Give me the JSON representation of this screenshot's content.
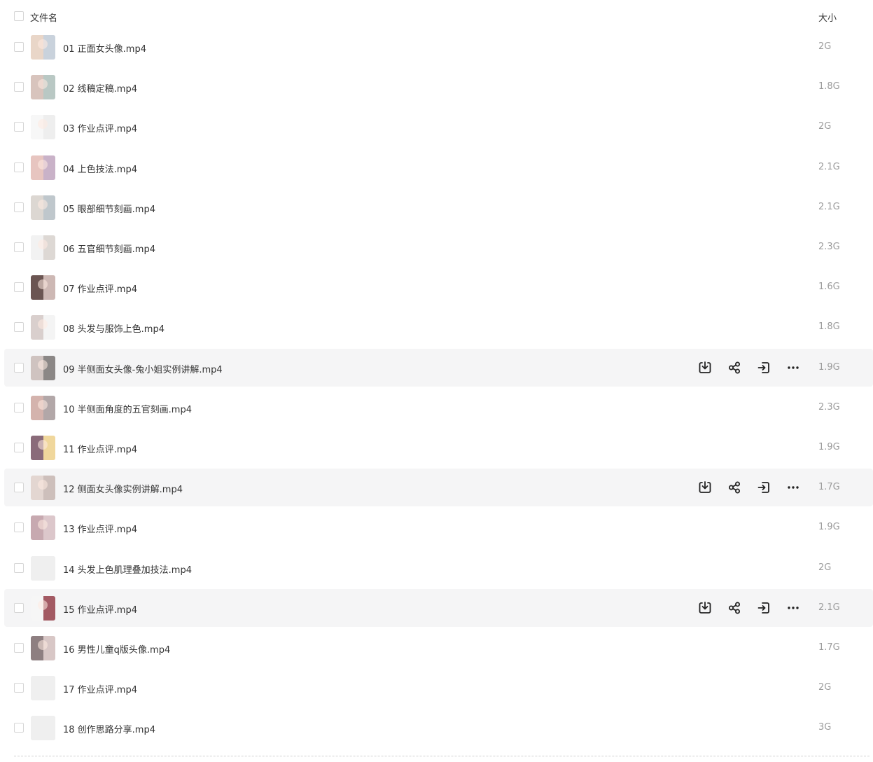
{
  "header": {
    "name_label": "文件名",
    "size_label": "大小"
  },
  "files": [
    {
      "name": "01 正面女头像.mp4",
      "size": "2G",
      "thumb": [
        "#e9d6c8",
        "#c9d2dc"
      ],
      "hovered": false
    },
    {
      "name": "02 线稿定稿.mp4",
      "size": "1.8G",
      "thumb": [
        "#d8c4bd",
        "#b9c8c4"
      ],
      "hovered": false
    },
    {
      "name": "03 作业点评.mp4",
      "size": "2G",
      "thumb": [
        "#f7f7f7",
        "#eeeeee"
      ],
      "hovered": false
    },
    {
      "name": "04 上色技法.mp4",
      "size": "2.1G",
      "thumb": [
        "#e7c5c0",
        "#c9b2c8"
      ],
      "hovered": false
    },
    {
      "name": "05 眼部细节刻画.mp4",
      "size": "2.1G",
      "thumb": [
        "#dcd7d2",
        "#bfc7cc"
      ],
      "hovered": false
    },
    {
      "name": "06 五官细节刻画.mp4",
      "size": "2.3G",
      "thumb": [
        "#f2f2f2",
        "#ddd8d4"
      ],
      "hovered": false
    },
    {
      "name": "07 作业点评.mp4",
      "size": "1.6G",
      "thumb": [
        "#6b5552",
        "#cdb8b4"
      ],
      "hovered": false
    },
    {
      "name": "08 头发与服饰上色.mp4",
      "size": "1.8G",
      "thumb": [
        "#d9cfcd",
        "#f4f4f4"
      ],
      "hovered": false
    },
    {
      "name": "09 半侧面女头像-兔小姐实例讲解.mp4",
      "size": "1.9G",
      "thumb": [
        "#cfc3c0",
        "#8b8786"
      ],
      "hovered": true
    },
    {
      "name": "10 半侧面角度的五官刻画.mp4",
      "size": "2.3G",
      "thumb": [
        "#d4b3ad",
        "#b2a7a8"
      ],
      "hovered": false
    },
    {
      "name": "11 作业点评.mp4",
      "size": "1.9G",
      "thumb": [
        "#8a6b7a",
        "#f0d79c"
      ],
      "hovered": false
    },
    {
      "name": "12 侧面女头像实例讲解.mp4",
      "size": "1.7G",
      "thumb": [
        "#e3d6d1",
        "#cdbfbb"
      ],
      "hovered": true
    },
    {
      "name": "13 作业点评.mp4",
      "size": "1.9G",
      "thumb": [
        "#c7a9b0",
        "#dcc7cb"
      ],
      "hovered": false
    },
    {
      "name": "14 头发上色肌理叠加技法.mp4",
      "size": "2G",
      "thumb": [
        "#efefef",
        "#efefef"
      ],
      "hovered": false
    },
    {
      "name": "15 作业点评.mp4",
      "size": "2.1G",
      "thumb": [
        "#f6f6f6",
        "#a35a63"
      ],
      "hovered": true
    },
    {
      "name": "16 男性儿童q版头像.mp4",
      "size": "1.7G",
      "thumb": [
        "#8e7f81",
        "#d8c7c6"
      ],
      "hovered": false
    },
    {
      "name": "17 作业点评.mp4",
      "size": "2G",
      "thumb": [
        "#efefef",
        "#efefef"
      ],
      "hovered": false
    },
    {
      "name": "18 创作思路分享.mp4",
      "size": "3G",
      "thumb": [
        "#efefef",
        "#efefef"
      ],
      "hovered": false
    }
  ],
  "row_actions": [
    "download-icon",
    "share-icon",
    "move-icon",
    "more-icon"
  ]
}
